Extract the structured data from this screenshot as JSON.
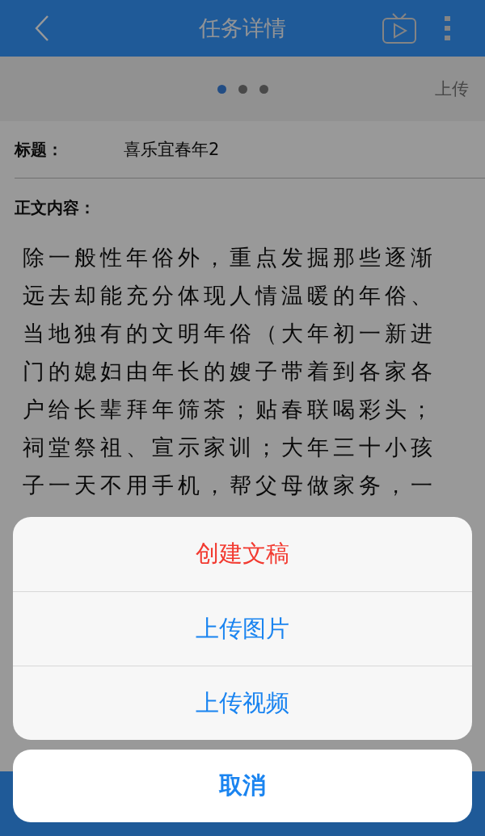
{
  "header": {
    "title": "任务详情"
  },
  "carousel": {
    "dots": [
      {
        "selected": true
      },
      {
        "selected": false
      },
      {
        "selected": false
      }
    ],
    "upload_label": "上传"
  },
  "form": {
    "title_label": "标题：",
    "title_value": "喜乐宜春年2",
    "content_label": "正文内容：",
    "content_lines": [
      "除一般性年俗外，重点发掘那些逐渐",
      "远去却能充分体现人情温暖的年俗、",
      "当地独有的文明年俗（大年初一新进",
      "门的媳妇由年长的嫂子带着到各家各",
      "户给长辈拜年筛茶；贴春联喝彩头；",
      "祠堂祭祖、宣示家训；大年三十小孩",
      "子一天不用手机，帮父母做家务，一"
    ]
  },
  "action_sheet": {
    "actions": [
      {
        "label": "创建文稿",
        "kind": "destructive"
      },
      {
        "label": "上传图片",
        "kind": "default"
      },
      {
        "label": "上传视频",
        "kind": "default"
      }
    ],
    "cancel": "取消"
  }
}
